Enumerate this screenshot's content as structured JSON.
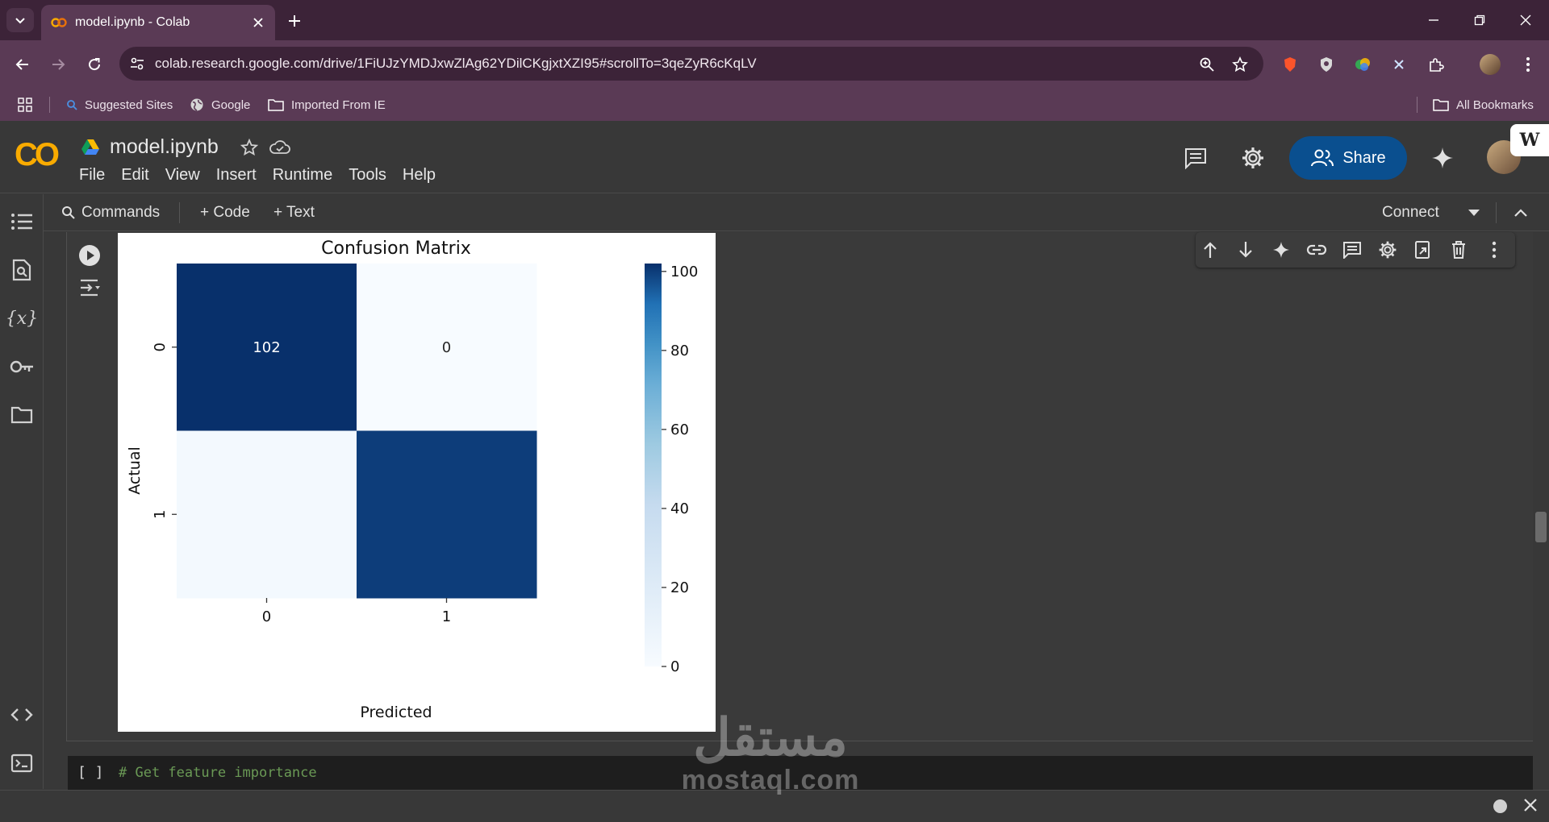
{
  "browser": {
    "tab_title": "model.ipynb - Colab",
    "url": "colab.research.google.com/drive/1FiUJzYMDJxwZlAg62YDilCKgjxtXZI95#scrollTo=3qeZyR6cKqLV",
    "bookmarks": [
      "Suggested Sites",
      "Google",
      "Imported From IE"
    ],
    "all_bookmarks": "All Bookmarks"
  },
  "colab": {
    "logo": "CO",
    "notebook_name": "model.ipynb",
    "menu": [
      "File",
      "Edit",
      "View",
      "Insert",
      "Runtime",
      "Tools",
      "Help"
    ],
    "share_label": "Share",
    "toolbar": {
      "commands": "Commands",
      "add_code": "+ Code",
      "add_text": "+ Text",
      "connect": "Connect"
    },
    "badge": "W"
  },
  "colors": {
    "brand_orange": "#f9ab00",
    "share_blue": "#0a4f8f",
    "cmap_dark": "#08306b",
    "cmap_light": "#f7fbff"
  },
  "chart_data": {
    "type": "heatmap",
    "title": "Confusion Matrix",
    "xlabel": "Predicted",
    "ylabel": "Actual",
    "x_categories": [
      "0",
      "1"
    ],
    "y_categories": [
      "0",
      "1"
    ],
    "values": [
      [
        102,
        0
      ],
      [
        3,
        100
      ]
    ],
    "annotations": [
      [
        "102",
        "0"
      ],
      [
        "",
        ""
      ]
    ],
    "colorbar": {
      "min": 0,
      "max": 102,
      "ticks": [
        0,
        20,
        40,
        60,
        80,
        100
      ]
    },
    "colormap": "Blues"
  },
  "next_cell": {
    "bracket": "[ ]",
    "code": "# Get feature importance"
  },
  "watermark": {
    "arabic": "مستقل",
    "latin": "mostaql.com"
  }
}
